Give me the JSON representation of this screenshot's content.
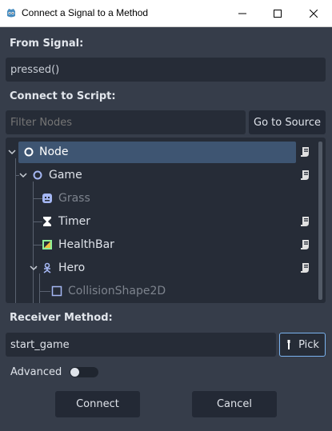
{
  "window": {
    "title": "Connect a Signal to a Method"
  },
  "from_signal": {
    "label": "From Signal:",
    "value": "pressed()"
  },
  "connect_script": {
    "label": "Connect to Script:",
    "filter_placeholder": "Filter Nodes",
    "go_to_source": "Go to Source"
  },
  "tree": {
    "items": [
      {
        "label": "Node",
        "icon": "node-icon",
        "selected": true,
        "has_script": true
      },
      {
        "label": "Game",
        "icon": "node-icon",
        "has_script": true
      },
      {
        "label": "Grass",
        "icon": "sprite-icon",
        "disabled": true,
        "has_script": false
      },
      {
        "label": "Timer",
        "icon": "timer-icon",
        "has_script": true
      },
      {
        "label": "HealthBar",
        "icon": "texture-progress-icon",
        "has_script": true
      },
      {
        "label": "Hero",
        "icon": "kinematic-body-icon",
        "has_script": true
      },
      {
        "label": "CollisionShape2D",
        "icon": "collision-shape-icon",
        "disabled": true,
        "has_script": false
      }
    ]
  },
  "receiver": {
    "label": "Receiver Method:",
    "value": "start_game",
    "pick": "Pick"
  },
  "advanced": {
    "label": "Advanced",
    "enabled": false
  },
  "actions": {
    "connect": "Connect",
    "cancel": "Cancel"
  },
  "colors": {
    "accent": "#3e5572",
    "pick_border": "#7ab3f0",
    "background": "#363d4a",
    "field": "#262c37"
  }
}
